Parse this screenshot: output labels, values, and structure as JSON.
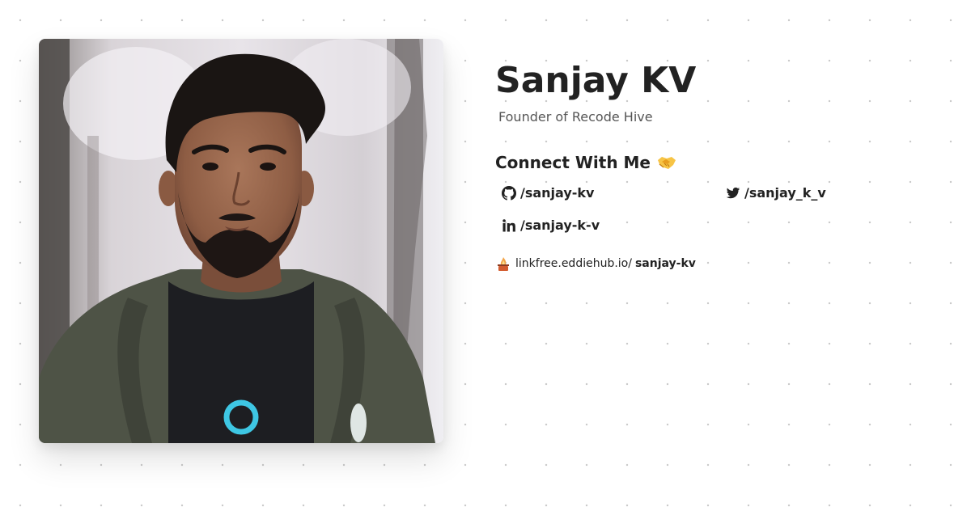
{
  "profile": {
    "name": "Sanjay KV",
    "role": "Founder of Recode Hive",
    "photo_alt": "profile-photo"
  },
  "connect": {
    "heading": "Connect With Me",
    "emoji": "handshake-icon"
  },
  "socials": [
    {
      "icon": "github-icon",
      "handle": "/sanjay-kv"
    },
    {
      "icon": "twitter-icon",
      "handle": "/sanjay_k_v"
    },
    {
      "icon": "linkedin-icon",
      "handle": "/sanjay-k-v"
    }
  ],
  "linkfree": {
    "icon": "linkfree-logo-icon",
    "domain": "linkfree.eddiehub.io/",
    "username": "sanjay-kv"
  },
  "colors": {
    "text": "#222222",
    "muted": "#555555",
    "background": "#ffffff",
    "dots": "#c9c9c9"
  }
}
